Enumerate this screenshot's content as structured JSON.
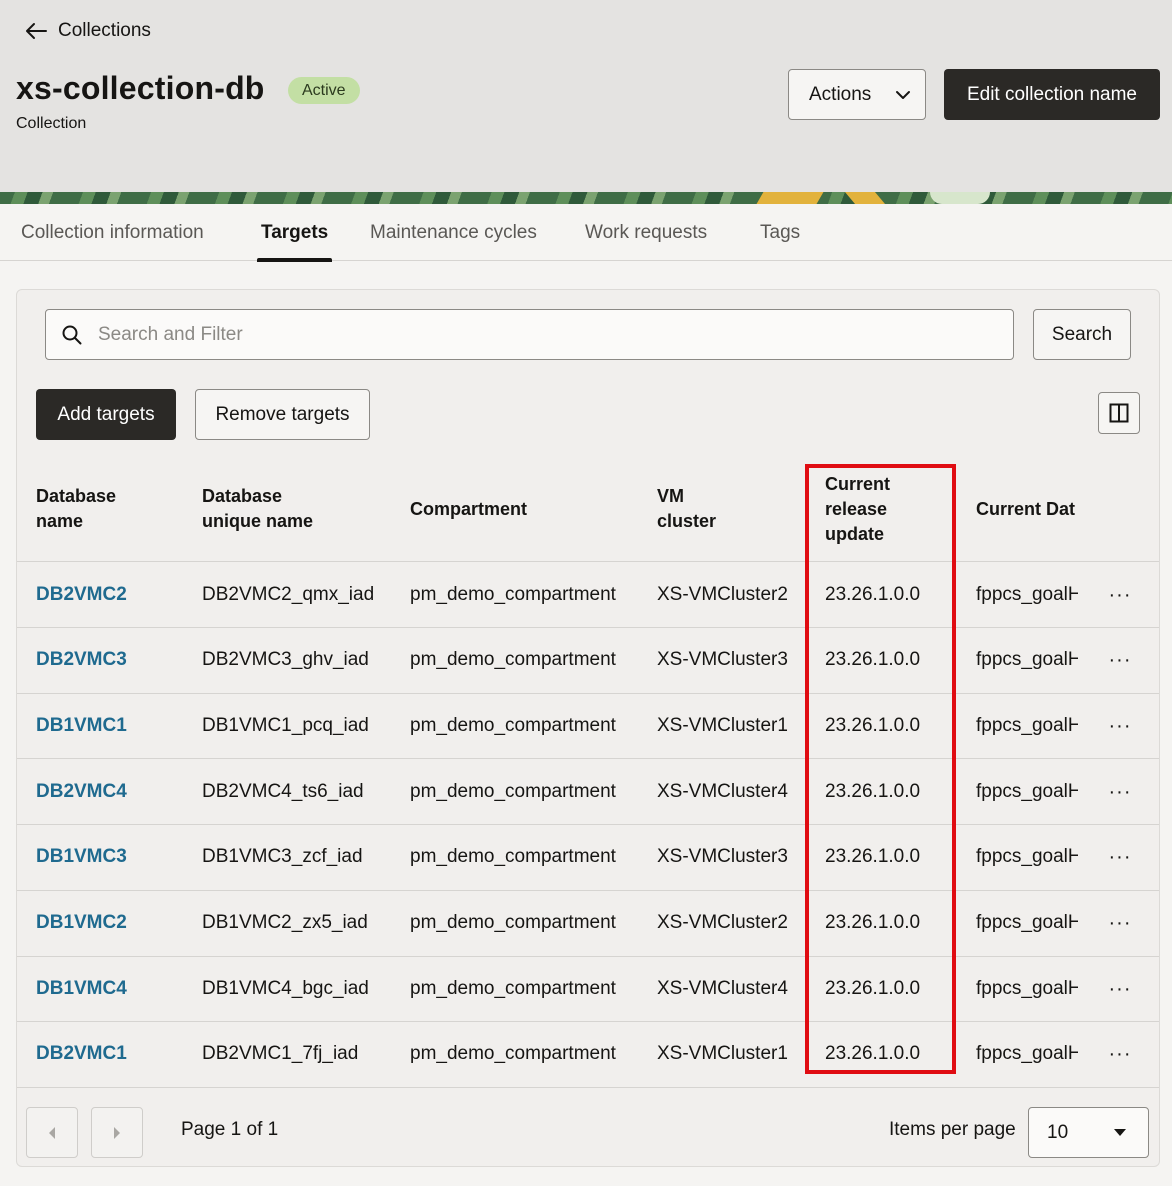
{
  "header": {
    "back_label": "Collections",
    "title": "xs-collection-db",
    "status": "Active",
    "subtitle": "Collection",
    "actions_label": "Actions",
    "edit_label": "Edit collection name"
  },
  "tabs": [
    {
      "label": "Collection information",
      "active": false
    },
    {
      "label": "Targets",
      "active": true
    },
    {
      "label": "Maintenance cycles",
      "active": false
    },
    {
      "label": "Work requests",
      "active": false
    },
    {
      "label": "Tags",
      "active": false
    }
  ],
  "toolbar": {
    "search_placeholder": "Search and Filter",
    "search_button": "Search",
    "add_button": "Add targets",
    "remove_button": "Remove targets",
    "columns_icon": "columns-icon"
  },
  "table": {
    "columns": [
      "Database\nname",
      "Database\nunique name",
      "Compartment",
      "VM\ncluster",
      "Current\nrelease\nupdate",
      "Current Dat"
    ],
    "rows": [
      {
        "db_name": "DB2VMC2",
        "unique_name": "DB2VMC2_qmx_iad",
        "compartment": "pm_demo_compartment",
        "vm_cluster": "XS-VMCluster2",
        "release_update": "23.26.1.0.0",
        "current_dat": "fppcs_goalH"
      },
      {
        "db_name": "DB2VMC3",
        "unique_name": "DB2VMC3_ghv_iad",
        "compartment": "pm_demo_compartment",
        "vm_cluster": "XS-VMCluster3",
        "release_update": "23.26.1.0.0",
        "current_dat": "fppcs_goalH"
      },
      {
        "db_name": "DB1VMC1",
        "unique_name": "DB1VMC1_pcq_iad",
        "compartment": "pm_demo_compartment",
        "vm_cluster": "XS-VMCluster1",
        "release_update": "23.26.1.0.0",
        "current_dat": "fppcs_goalH"
      },
      {
        "db_name": "DB2VMC4",
        "unique_name": "DB2VMC4_ts6_iad",
        "compartment": "pm_demo_compartment",
        "vm_cluster": "XS-VMCluster4",
        "release_update": "23.26.1.0.0",
        "current_dat": "fppcs_goalH"
      },
      {
        "db_name": "DB1VMC3",
        "unique_name": "DB1VMC3_zcf_iad",
        "compartment": "pm_demo_compartment",
        "vm_cluster": "XS-VMCluster3",
        "release_update": "23.26.1.0.0",
        "current_dat": "fppcs_goalH"
      },
      {
        "db_name": "DB1VMC2",
        "unique_name": "DB1VMC2_zx5_iad",
        "compartment": "pm_demo_compartment",
        "vm_cluster": "XS-VMCluster2",
        "release_update": "23.26.1.0.0",
        "current_dat": "fppcs_goalH"
      },
      {
        "db_name": "DB1VMC4",
        "unique_name": "DB1VMC4_bgc_iad",
        "compartment": "pm_demo_compartment",
        "vm_cluster": "XS-VMCluster4",
        "release_update": "23.26.1.0.0",
        "current_dat": "fppcs_goalH"
      },
      {
        "db_name": "DB2VMC1",
        "unique_name": "DB2VMC1_7fj_iad",
        "compartment": "pm_demo_compartment",
        "vm_cluster": "XS-VMCluster1",
        "release_update": "23.26.1.0.0",
        "current_dat": "fppcs_goalH"
      }
    ],
    "row_menu_label": "···"
  },
  "pagination": {
    "page_label": "Page 1 of 1",
    "items_per_page_label": "Items per page",
    "items_per_page_value": "10"
  },
  "colors": {
    "highlight": "#e00c12",
    "link": "#1f6a8f",
    "primary_button": "#2b2926",
    "badge_active": "#c3dfa4"
  }
}
